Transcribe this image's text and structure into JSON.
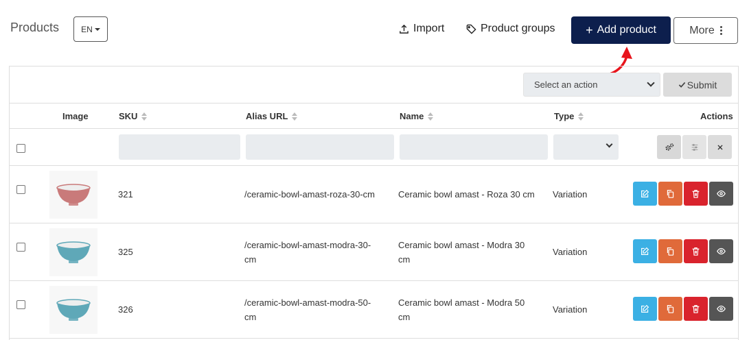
{
  "header": {
    "title": "Products",
    "language": "EN",
    "import_label": "Import",
    "product_groups_label": "Product groups",
    "add_product_label": "Add product",
    "more_label": "More"
  },
  "bulk": {
    "select_placeholder": "Select an action",
    "submit_label": "Submit"
  },
  "table": {
    "columns": {
      "image": "Image",
      "sku": "SKU",
      "alias_url": "Alias URL",
      "name": "Name",
      "type": "Type",
      "actions": "Actions"
    },
    "rows": [
      {
        "sku": "321",
        "alias_line1": "/ceramic-bowl-amast-roza-30-cm",
        "alias_line2": "",
        "name_line1": "Ceramic bowl amast - Roza 30 cm",
        "name_line2": "",
        "type": "Variation",
        "image_color": "#c97a7a"
      },
      {
        "sku": "325",
        "alias_line1": "/ceramic-bowl-amast-modra-30-",
        "alias_line2": "cm",
        "name_line1": "Ceramic bowl amast - Modra 30",
        "name_line2": "cm",
        "type": "Variation",
        "image_color": "#5fa8b8"
      },
      {
        "sku": "326",
        "alias_line1": "/ceramic-bowl-amast-modra-50-",
        "alias_line2": "cm",
        "name_line1": "Ceramic bowl amast - Modra 50",
        "name_line2": "cm",
        "type": "Variation",
        "image_color": "#5fa8b8"
      }
    ]
  },
  "colors": {
    "primary": "#0d1f4d",
    "edit": "#3bb0e4",
    "copy": "#e06a3a",
    "delete": "#d9232d",
    "view": "#555555",
    "annotation_arrow": "#e8141c"
  }
}
